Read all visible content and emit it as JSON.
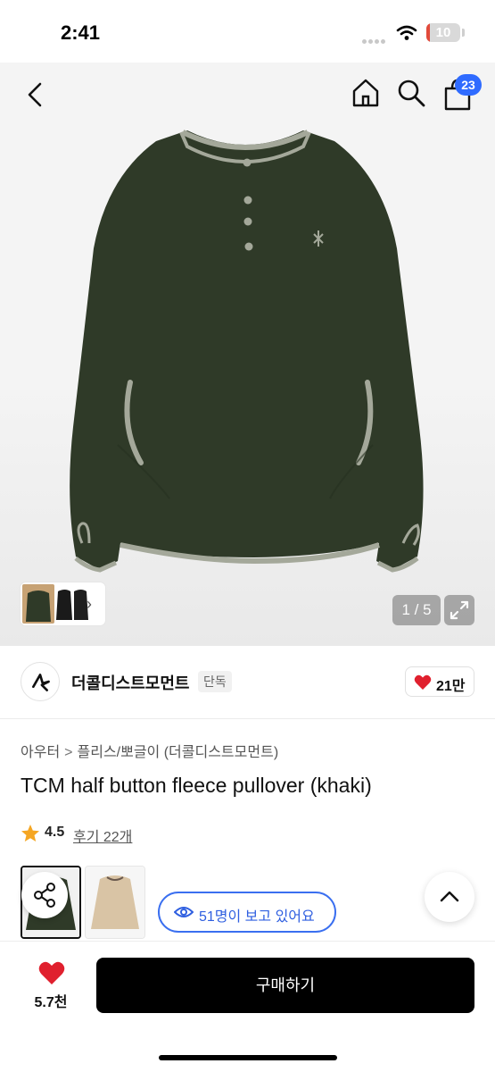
{
  "status_bar": {
    "time": "2:41",
    "battery_level": "10",
    "battery_fraction": 0.1
  },
  "header": {
    "cart_count": "23"
  },
  "gallery": {
    "page_indicator": "1 / 5",
    "current_page": 1,
    "total_pages": 5
  },
  "brand": {
    "name": "더콜디스트모먼트",
    "badge": "단독",
    "like_count": "21만"
  },
  "breadcrumb": {
    "category": "아우터",
    "separator": ">",
    "subcategory": "플리스/뽀글이 (더콜디스트모먼트)"
  },
  "product": {
    "title": "TCM half button fleece pullover (khaki)",
    "rating": "4.5",
    "rating_value": 4.5,
    "reviews_label": "후기 22개"
  },
  "colors": {
    "options": [
      "khaki",
      "beige"
    ],
    "accent": "#2f6bff",
    "product_color": "#2f3a28",
    "trim_color": "#a4a89a"
  },
  "viewers": {
    "text": "51명이 보고 있어요"
  },
  "bottom_bar": {
    "wish_count": "5.7천",
    "buy_label": "구매하기"
  }
}
